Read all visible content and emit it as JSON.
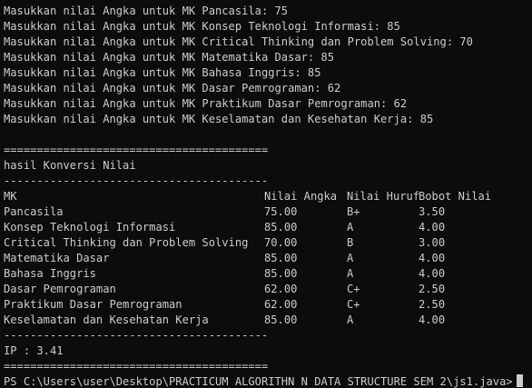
{
  "input_prompts": [
    "Masukkan nilai Angka untuk MK Pancasila: 75",
    "Masukkan nilai Angka untuk MK Konsep Teknologi Informasi: 85",
    "Masukkan nilai Angka untuk MK Critical Thinking dan Problem Solving: 70",
    "Masukkan nilai Angka untuk MK Matematika Dasar: 85",
    "Masukkan nilai Angka untuk MK Bahasa Inggris: 85",
    "Masukkan nilai Angka untuk MK Dasar Pemrograman: 62",
    "Masukkan nilai Angka untuk MK Praktikum Dasar Pemrograman: 62",
    "Masukkan nilai Angka untuk MK Keselamatan dan Kesehatan Kerja: 85"
  ],
  "separator_double": "========================================",
  "separator_single": "----------------------------------------",
  "section_title": "hasil Konversi Nilai",
  "table": {
    "headers": {
      "mk": "MK",
      "nilai_angka": "Nilai Angka",
      "nilai_huruf": "Nilai Huruf",
      "bobot_nilai": "Bobot Nilai"
    },
    "rows": [
      {
        "mk": "Pancasila",
        "nilai_angka": "75.00",
        "nilai_huruf": "B+",
        "bobot_nilai": "3.50"
      },
      {
        "mk": "Konsep Teknologi Informasi",
        "nilai_angka": "85.00",
        "nilai_huruf": "A",
        "bobot_nilai": "4.00"
      },
      {
        "mk": "Critical Thinking dan Problem Solving",
        "nilai_angka": "70.00",
        "nilai_huruf": "B",
        "bobot_nilai": "3.00"
      },
      {
        "mk": "Matematika Dasar",
        "nilai_angka": "85.00",
        "nilai_huruf": "A",
        "bobot_nilai": "4.00"
      },
      {
        "mk": "Bahasa Inggris",
        "nilai_angka": "85.00",
        "nilai_huruf": "A",
        "bobot_nilai": "4.00"
      },
      {
        "mk": "Dasar Pemrograman",
        "nilai_angka": "62.00",
        "nilai_huruf": "C+",
        "bobot_nilai": "2.50"
      },
      {
        "mk": "Praktikum Dasar Pemrograman",
        "nilai_angka": "62.00",
        "nilai_huruf": "C+",
        "bobot_nilai": "2.50"
      },
      {
        "mk": "Keselamatan dan Kesehatan Kerja",
        "nilai_angka": "85.00",
        "nilai_huruf": "A",
        "bobot_nilai": "4.00"
      }
    ]
  },
  "ip_line": "IP : 3.41",
  "prompt": "PS C:\\Users\\user\\Desktop\\PRACTICUM ALGORITHN N DATA STRUCTURE SEM 2\\js1.java>"
}
